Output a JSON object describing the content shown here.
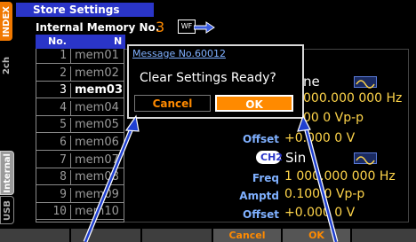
{
  "left_tabs": {
    "index": "INDEX",
    "second": "2ch",
    "internal": "Internal",
    "usb": "USB"
  },
  "header": {
    "title": "Store Settings",
    "memory_label": "Internal Memory No.",
    "memory_no": "3",
    "wf_label": "WF"
  },
  "table": {
    "col_no": "No.",
    "col_name": "N",
    "rows": [
      {
        "no": "1",
        "name": "mem01"
      },
      {
        "no": "2",
        "name": "mem02"
      },
      {
        "no": "3",
        "name": "mem03"
      },
      {
        "no": "4",
        "name": "mem04"
      },
      {
        "no": "5",
        "name": "mem05"
      },
      {
        "no": "6",
        "name": "mem06"
      },
      {
        "no": "7",
        "name": "mem07"
      },
      {
        "no": "8",
        "name": "mem08"
      },
      {
        "no": "9",
        "name": "mem09"
      },
      {
        "no": "10",
        "name": "mem10"
      }
    ]
  },
  "settings": {
    "ch1_func_frag": "ne",
    "ch1_freq_frag": "000.000 000 Hz",
    "ch1_ampl_frag": "00 0 Vp-p",
    "ch1_offset_label": "Offset",
    "ch1_offset_val": "+0.000 0 V",
    "ch2_badge": "CH2",
    "ch2_func_frag": "Sin",
    "ch2_freq_label": "Freq",
    "ch2_freq_val": "1 000.000 000 Hz",
    "ch2_ampl_label": "Amptd",
    "ch2_ampl_val": "0.100 0 Vp-p",
    "ch2_offset_label": "Offset",
    "ch2_offset_val": "+0.000 0 V"
  },
  "dialog": {
    "message_id": "Message No.60012",
    "text": "Clear Settings Ready?",
    "cancel_label": "Cancel",
    "ok_label": "OK"
  },
  "softkeys": {
    "cancel": "Cancel",
    "ok": "OK"
  },
  "colors": {
    "ok_orange": "#ff8a00",
    "label_blue": "#7fb0ff",
    "value_yellow": "#ffd54a",
    "title_blue": "#2a35c8",
    "arrow_blue": "#1f3fd0"
  }
}
